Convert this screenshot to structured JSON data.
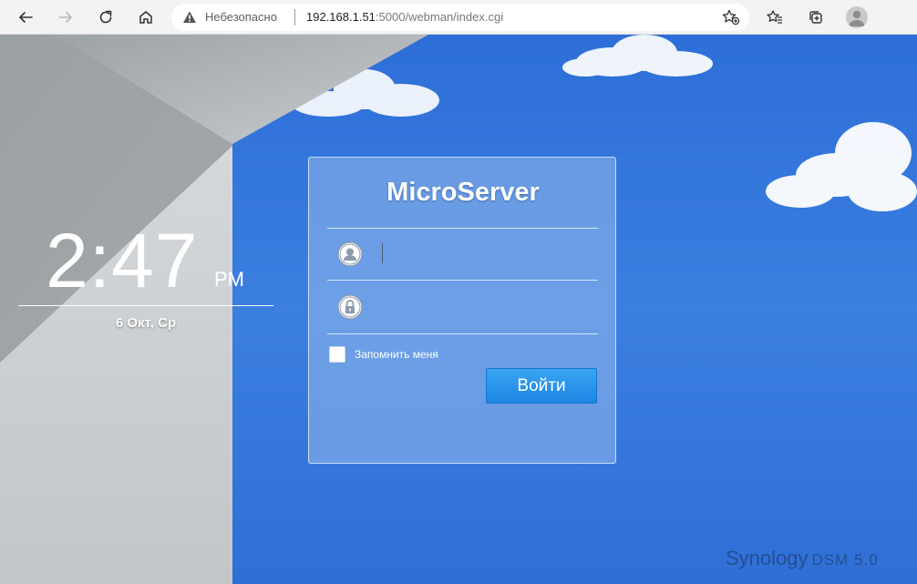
{
  "browser": {
    "insecure_label": "Небезопасно",
    "url_host": "192.168.1.51",
    "url_rest": ":5000/webman/index.cgi",
    "icons": [
      "back-arrow-icon",
      "forward-arrow-icon",
      "reload-icon",
      "home-icon",
      "warning-icon",
      "add-favorite-icon",
      "favorites-icon",
      "collections-icon",
      "profile-icon"
    ]
  },
  "clock": {
    "time": "2:47",
    "ampm": "PM",
    "date": "6 Окт, Ср"
  },
  "login": {
    "title": "MicroServer",
    "username_value": "",
    "password_value": "",
    "remember_label": "Запомнить меня",
    "remember_checked": false,
    "submit_label": "Войти"
  },
  "brand": {
    "vendor": "Synology",
    "product": "DSM 5.0"
  },
  "colors": {
    "sky": "#3b7fe0",
    "button": "#2b95ea",
    "toolbar": "#f3f3f3"
  }
}
